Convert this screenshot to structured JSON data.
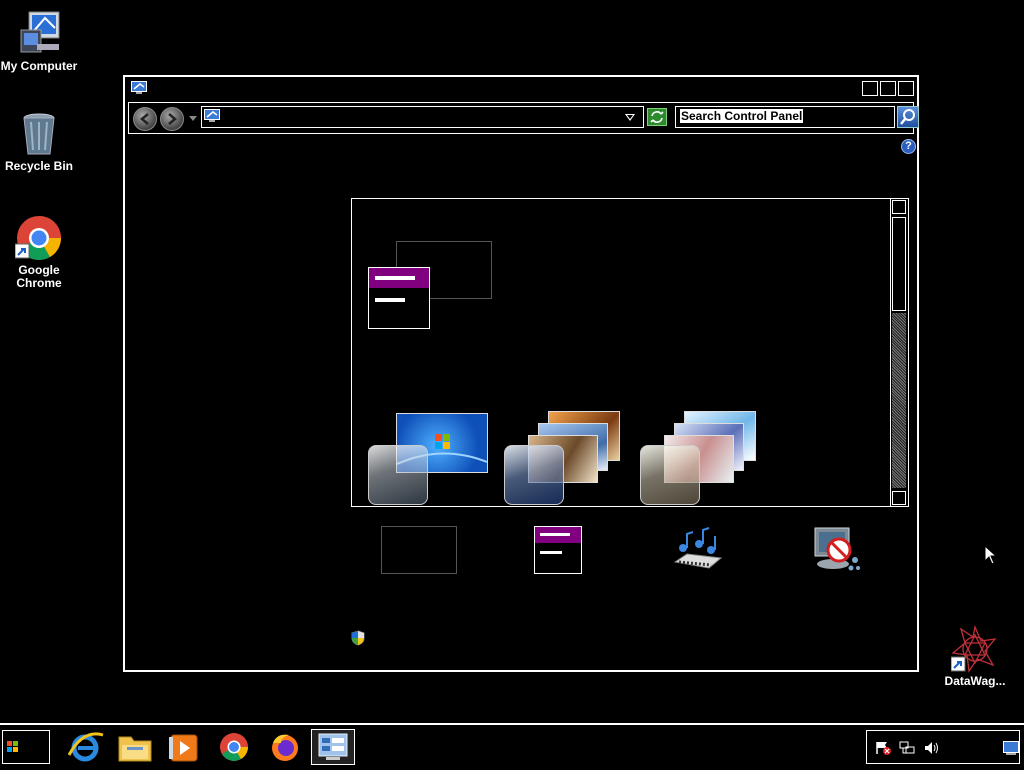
{
  "desktop": {
    "icons": [
      {
        "label": "My Computer",
        "icon": "computer-icon"
      },
      {
        "label": "Recycle Bin",
        "icon": "recycle-bin-icon"
      },
      {
        "label": "Google Chrome",
        "icon": "chrome-icon"
      },
      {
        "label": "DataWag...",
        "icon": "datawag-icon"
      }
    ]
  },
  "window": {
    "icon": "control-panel-icon",
    "buttons": [
      "minimize",
      "maximize",
      "close"
    ],
    "navbar": {
      "back": "back-arrow-icon",
      "forward": "forward-arrow-icon",
      "address_value": "",
      "search_placeholder": "Search Control Panel"
    },
    "help_label": "?",
    "themes": [
      {
        "name": "windows-7-theme"
      },
      {
        "name": "architecture-theme"
      },
      {
        "name": "landscapes-theme"
      }
    ],
    "bottom_icons": [
      "desktop-background-icon",
      "window-color-icon",
      "sounds-icon",
      "screen-saver-icon"
    ]
  },
  "taskbar": {
    "apps": [
      "internet-explorer-icon",
      "file-explorer-icon",
      "media-player-icon",
      "chrome-icon",
      "firefox-icon",
      "control-panel-icon"
    ],
    "active_app": "control-panel-icon",
    "tray": [
      "action-center-icon",
      "network-icon",
      "volume-icon",
      "show-desktop-icon"
    ]
  }
}
